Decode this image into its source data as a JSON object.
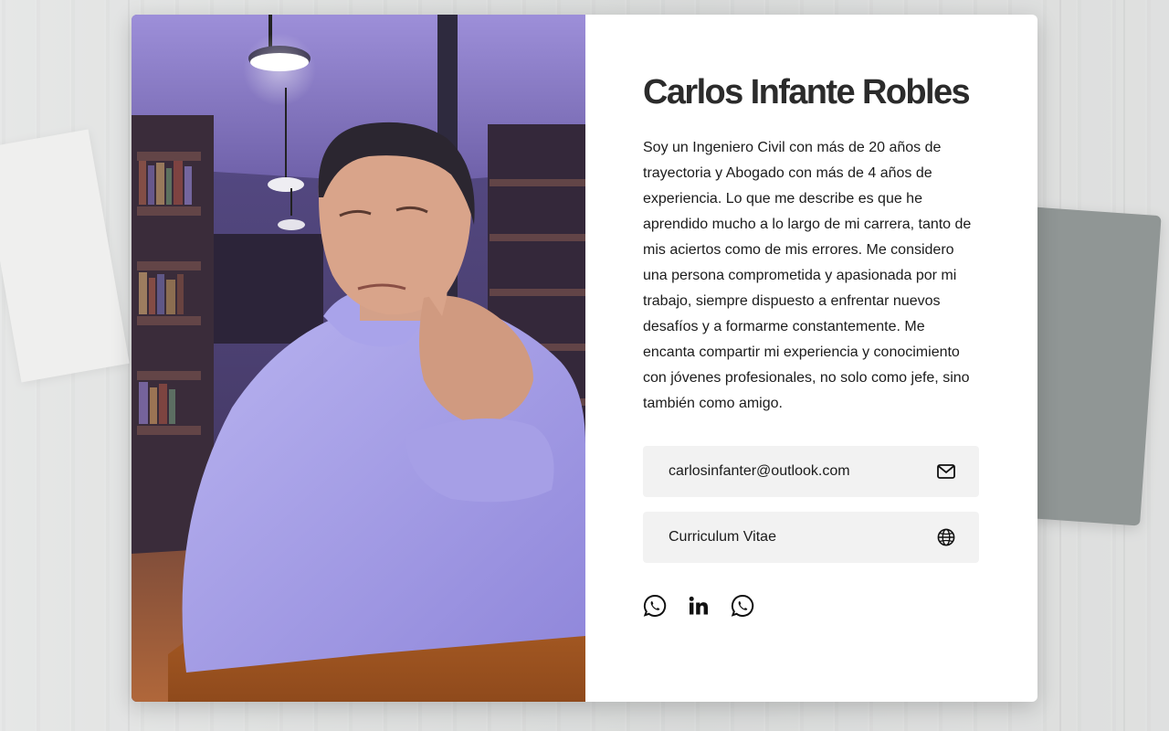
{
  "profile": {
    "name": "Carlos Infante Robles",
    "bio": "Soy un Ingeniero Civil con más de 20 años de trayectoria y Abogado con más de 4 años de experiencia. Lo que me describe es que he aprendido mucho a lo largo de mi carrera, tanto de mis aciertos como de mis errores. Me considero una persona comprometida y apasionada por mi trabajo, siempre dispuesto a enfrentar nuevos desafíos y a formarme constantemente. Me encanta compartir mi experiencia y conocimiento con jóvenes profesionales, no solo como jefe, sino también como amigo."
  },
  "links": {
    "email": {
      "label": "carlosinfanter@outlook.com",
      "icon": "mail-icon"
    },
    "cv": {
      "label": "Curriculum Vitae",
      "icon": "globe-icon"
    }
  },
  "socials": [
    {
      "icon": "whatsapp-icon"
    },
    {
      "icon": "linkedin-icon"
    },
    {
      "icon": "whatsapp-icon"
    }
  ],
  "colors": {
    "card_bg": "#ffffff",
    "text": "#1c1c1c",
    "heading": "#2b2b2b",
    "link_bg": "#f2f2f2",
    "photo_tint": "#8a7fd6"
  }
}
